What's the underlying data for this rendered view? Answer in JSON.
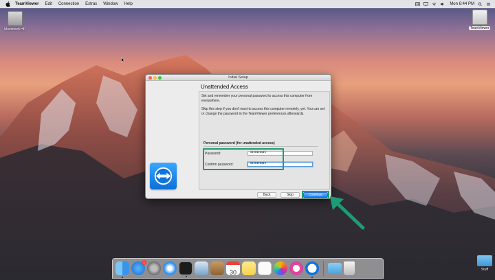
{
  "menubar": {
    "app_name": "TeamViewer",
    "items": [
      "Edit",
      "Connection",
      "Extras",
      "Window",
      "Help"
    ],
    "clock": "Mon 6:44 PM"
  },
  "desktop": {
    "hd_label": "Macintosh HD",
    "teamviewer_label": "TeamViewer",
    "folder_label": "Stuff"
  },
  "window": {
    "title": "Initial Setup",
    "heading": "Unattended Access",
    "desc1": "Set and remember your personal password to access this computer from everywhere.",
    "desc2": "Skip this step if you don't want to access this computer remotely, yet. You can set or change the password in the TeamViewer preferences afterwards.",
    "group_title": "Personal password (for unattended access)",
    "password_label": "Password:",
    "password_value": "••••••••••",
    "confirm_label": "Confirm password:",
    "confirm_value": "••••••••••",
    "back_label": "Back",
    "skip_label": "Skip",
    "continue_label": "Continue"
  },
  "dock": {
    "appstore_badge": "1",
    "calendar_day": "30",
    "icons": [
      "finder-icon",
      "app-store-icon",
      "system-preferences-icon",
      "safari-icon",
      "terminal-icon",
      "preview-icon",
      "contacts-icon",
      "calendar-icon",
      "notes-icon",
      "reminders-icon",
      "photos-icon",
      "itunes-icon",
      "teamviewer-icon",
      "folder-icon",
      "trash-icon"
    ]
  },
  "colors": {
    "highlight": "#1d9c74",
    "accent_blue": "#1a82f7"
  }
}
